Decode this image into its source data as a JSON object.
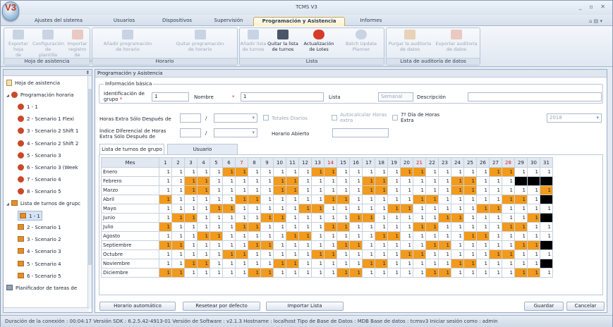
{
  "app": {
    "title": "TCMS V3",
    "logo": "V3"
  },
  "tabs": [
    "Ajustes del sistema",
    "Usuarios",
    "Dispositivos",
    "Supervisión",
    "Programación y Asistencia",
    "Informes"
  ],
  "ribbon": {
    "groups": [
      "Hoja de asistencia",
      "Horario",
      "Lista",
      "Lista de auditoría de datos"
    ],
    "buttons": [
      {
        "l1": "Exportar hoja",
        "l2": "de asistencia"
      },
      {
        "l1": "Configuración de",
        "l2": "plantilla"
      },
      {
        "l1": "Importar registro",
        "l2": "de transacciones"
      },
      {
        "l1": "Añadir programación",
        "l2": "de horario"
      },
      {
        "l1": "Quitar programación",
        "l2": "de horario"
      },
      {
        "l1": "Añadir lista",
        "l2": "de turnos"
      },
      {
        "l1": "Quitar la lista",
        "l2": "de turnos"
      },
      {
        "l1": "Actualización",
        "l2": "de Lotes"
      },
      {
        "l1": "Batch Update",
        "l2": "Planner"
      },
      {
        "l1": "Purgar la auditoría",
        "l2": "de datos"
      },
      {
        "l1": "Exportar auditoría",
        "l2": "de datos"
      }
    ]
  },
  "tree": {
    "pin": "‡",
    "items": [
      {
        "label": "Hoja de asistencia",
        "icon": "doc"
      },
      {
        "label": "Programación horaria",
        "icon": "sched",
        "exp": "◢"
      },
      {
        "label": "1 - 1",
        "icon": "sched"
      },
      {
        "label": "2 - Scenario 1 Flexi",
        "icon": "sched"
      },
      {
        "label": "3 - Scenario 2 Shift 1",
        "icon": "sched"
      },
      {
        "label": "4 - Scenario 2 Shift 2",
        "icon": "sched"
      },
      {
        "label": "5 - Scenario 3",
        "icon": "sched"
      },
      {
        "label": "6 - Scenario 3 (Week",
        "icon": "sched"
      },
      {
        "label": "7 - Scenario 4",
        "icon": "sched"
      },
      {
        "label": "8 - Scenario 5",
        "icon": "sched"
      },
      {
        "label": "Lista de turnos de grupc",
        "icon": "list",
        "exp": "◢"
      },
      {
        "label": "1 - 1",
        "icon": "list"
      },
      {
        "label": "2 - Scenario 1",
        "icon": "list"
      },
      {
        "label": "3 - Scenario 2",
        "icon": "list"
      },
      {
        "label": "4 - Scenario 3",
        "icon": "list"
      },
      {
        "label": "5 - Scenario 4",
        "icon": "list"
      },
      {
        "label": "6 - Scenario 5",
        "icon": "list"
      },
      {
        "label": "Planificador de tareas de",
        "icon": "task"
      }
    ]
  },
  "panel": {
    "title": "Programación y Asistencia"
  },
  "form": {
    "legend": "Información básica",
    "id_label": "Identificación de grupo",
    "id_value": "1",
    "name_label": "Nombre",
    "name_value": "1",
    "list_label": "Lista",
    "list_value": "Semanal",
    "desc_label": "Descripción",
    "ot_label": "Horas Extra Sólo Después de",
    "diff_label": "Índice Diferencial de Horas Extra Sólo Después de",
    "slash": "/",
    "totales": "Totales Diarios",
    "autocalc": "Autocalcular Horas extra",
    "seventh": "7º Día de Horas Extra",
    "abierto": "Horario Abierto",
    "year": "2018",
    "req": "*"
  },
  "subtabs": [
    "Lista de turnos de grupo",
    "Usuario"
  ],
  "grid": {
    "header": "Mes",
    "days": [
      "1",
      "2",
      "3",
      "4",
      "5",
      "6",
      "7",
      "8",
      "9",
      "10",
      "11",
      "12",
      "13",
      "14",
      "15",
      "16",
      "17",
      "18",
      "19",
      "20",
      "21",
      "22",
      "23",
      "24",
      "25",
      "26",
      "27",
      "28",
      "29",
      "30",
      "31"
    ],
    "red_days": [
      7,
      14,
      21,
      28
    ],
    "months": [
      "Enero",
      "Febrero",
      "Marzo",
      "Abril",
      "Mayo",
      "Junio",
      "Julio",
      "Agosto",
      "Septiembre",
      "Octubre",
      "Noviembre",
      "Diciembre"
    ],
    "orange": [
      [
        6,
        7,
        13,
        14,
        20,
        21,
        27,
        28
      ],
      [
        3,
        4,
        10,
        11,
        17,
        18,
        24,
        25
      ],
      [
        3,
        4,
        10,
        11,
        17,
        18,
        24,
        25,
        31
      ],
      [
        1,
        7,
        8,
        14,
        15,
        21,
        22,
        28,
        29
      ],
      [
        5,
        6,
        12,
        13,
        19,
        20,
        26,
        27
      ],
      [
        2,
        3,
        9,
        10,
        16,
        17,
        23,
        24,
        30
      ],
      [
        1,
        7,
        8,
        14,
        15,
        21,
        22,
        28,
        29
      ],
      [
        4,
        5,
        11,
        12,
        18,
        19,
        25,
        26
      ],
      [
        1,
        2,
        8,
        9,
        15,
        16,
        22,
        23,
        29,
        30
      ],
      [
        6,
        7,
        13,
        14,
        20,
        21,
        27,
        28
      ],
      [
        3,
        4,
        10,
        11,
        17,
        18,
        24,
        25
      ],
      [
        1,
        2,
        8,
        9,
        15,
        16,
        22,
        23,
        29,
        30
      ]
    ],
    "black": [
      [],
      [
        29,
        30,
        31
      ],
      [],
      [
        31
      ],
      [],
      [
        31
      ],
      [],
      [],
      [
        31
      ],
      [],
      [
        31
      ],
      []
    ],
    "value": "1"
  },
  "buttons": {
    "auto": "Horario automático",
    "reset": "Resetear por defecto",
    "import": "Importar Lista",
    "save": "Guardar",
    "cancel": "Cancelar"
  },
  "status": "Duración de la conexión : 00:04:17     Versión SDK : 6.2.5.42-4913-01     Versión de Software : v2.1.3     Hostname : localhost     Tipo de Base de Datos : MDB     Base de datos : tcmsv3     Iniciar sesión como : admin",
  "colors": {
    "weekend": "#f29a1c",
    "invalid": "#000000",
    "accent": "#d3232a"
  }
}
